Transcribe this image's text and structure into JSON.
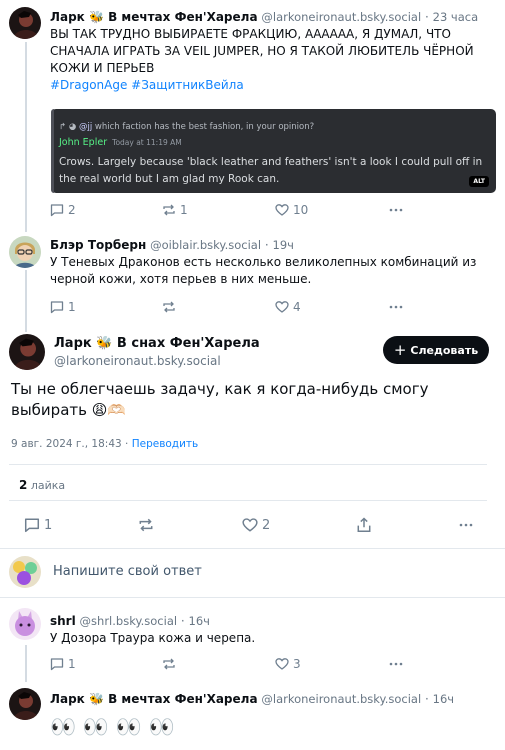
{
  "posts": [
    {
      "author": "Ларк 🐝 В мечтах Фен'Харела",
      "handle": "@larkoneironaut.bsky.social",
      "time": "23 часа",
      "text": "ВЫ ТАК ТРУДНО ВЫБИРАЕТЕ ФРАКЦИЮ, АААААА, Я ДУМАЛ, ЧТО СНАЧАЛА ИГРАТЬ ЗА VEIL JUMPER, НО Я ТАКОЙ ЛЮБИТЕЛЬ ЧЁРНОЙ КОЖИ И ПЕРЬЕВ",
      "tags": "#DragonAge #ЗащитникВейла",
      "embed": {
        "reply_mention": "@jj",
        "reply_text": "which faction has the best fashion, in your opinion?",
        "author": "John Epler",
        "time": "Today at 11:19 AM",
        "message": "Crows. Largely because 'black leather and feathers' isn't a look I could pull off in the real world but I am glad my Rook can.",
        "alt_badge": "ALT"
      },
      "counts": {
        "replies": "2",
        "reposts": "1",
        "likes": "10"
      }
    },
    {
      "author": "Блэр Торберн",
      "handle": "@oiblair.bsky.social",
      "time": "19ч",
      "text": "У Теневых Драконов есть несколько великолепных комбинаций из черной кожи, хотя перьев в них меньше.",
      "counts": {
        "replies": "1",
        "reposts": "",
        "likes": "4"
      }
    }
  ],
  "main_post": {
    "author": "Ларк 🐝 В снах Фен'Харела",
    "handle": "@larkoneironaut.bsky.social",
    "follow_label": "Следовать",
    "text": "Ты не облегчаешь задачу, как я когда-нибудь смогу выбирать 😩🫶🏻",
    "date": "9 авг. 2024 г., 18:43",
    "translate": "Переводить",
    "likes_count": "2",
    "likes_label": "лайка",
    "counts": {
      "replies": "1",
      "reposts": "",
      "likes": "2"
    }
  },
  "reply_composer": {
    "placeholder": "Напишите свой ответ"
  },
  "replies": [
    {
      "author": "shrl",
      "handle": "@shrl.bsky.social",
      "time": "16ч",
      "text": "У Дозора Траура кожа и черепа.",
      "counts": {
        "replies": "1",
        "reposts": "",
        "likes": "3"
      }
    },
    {
      "author": "Ларк 🐝 В мечтах Фен'Харела",
      "handle": "@larkoneironaut.bsky.social",
      "time": "16ч",
      "text": "👀 👀 👀 👀"
    }
  ],
  "colors": {
    "link": "#1083fe",
    "muted": "#687684",
    "button_bg": "#0b0f14"
  }
}
